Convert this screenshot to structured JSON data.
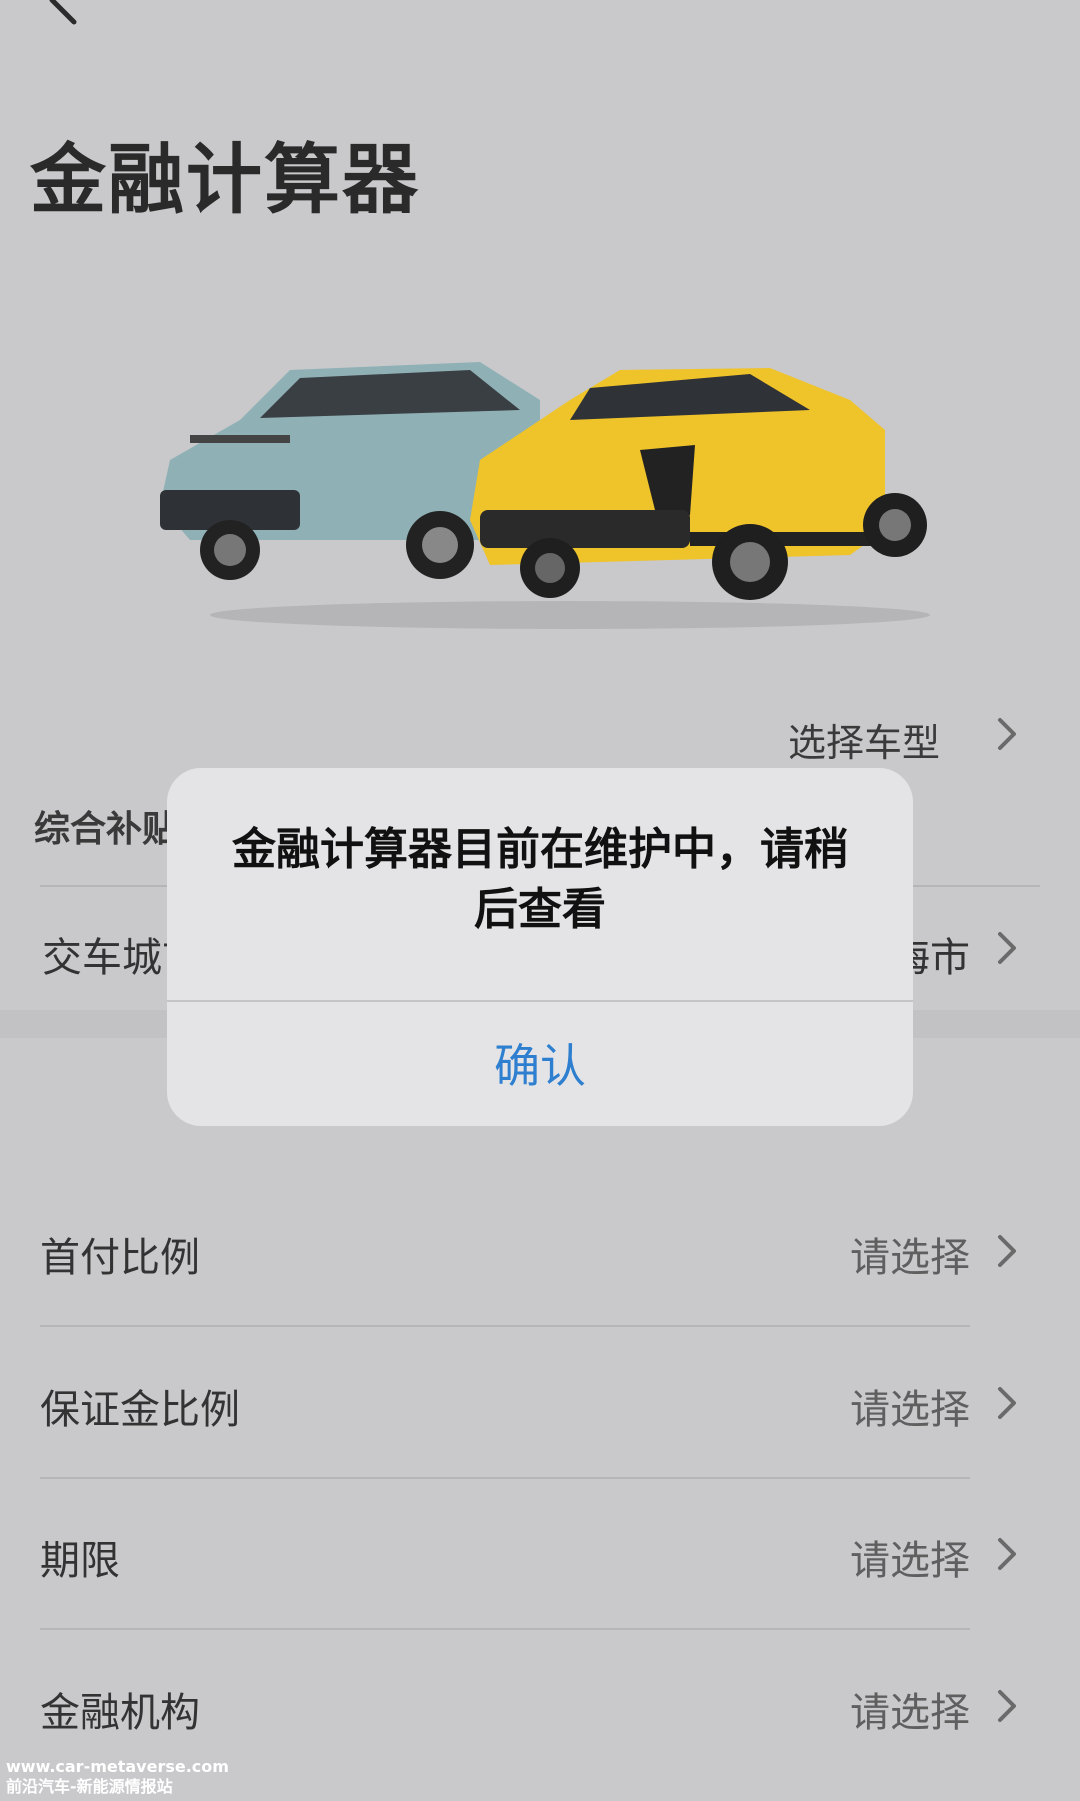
{
  "header": {
    "title": "金融计算器"
  },
  "vehicle": {
    "choose_label": "选择车型"
  },
  "subsidy": {
    "label": "综合补贴"
  },
  "city": {
    "label": "交车城市",
    "value": "上海市"
  },
  "options": [
    {
      "label": "首付比例",
      "value": "请选择"
    },
    {
      "label": "保证金比例",
      "value": "请选择"
    },
    {
      "label": "期限",
      "value": "请选择"
    },
    {
      "label": "金融机构",
      "value": "请选择"
    }
  ],
  "dialog": {
    "message": "金融计算器目前在维护中，请稍后查看",
    "confirm_label": "确认"
  },
  "watermark": {
    "line1": "www.car-metaverse.com",
    "line2": "前沿汽车-新能源情报站"
  },
  "colors": {
    "background": "#c9c9cb",
    "dialog_bg": "#e4e4e6",
    "accent": "#2e7fcf",
    "car_left": "#8fb1b6",
    "car_right": "#efc32a"
  }
}
